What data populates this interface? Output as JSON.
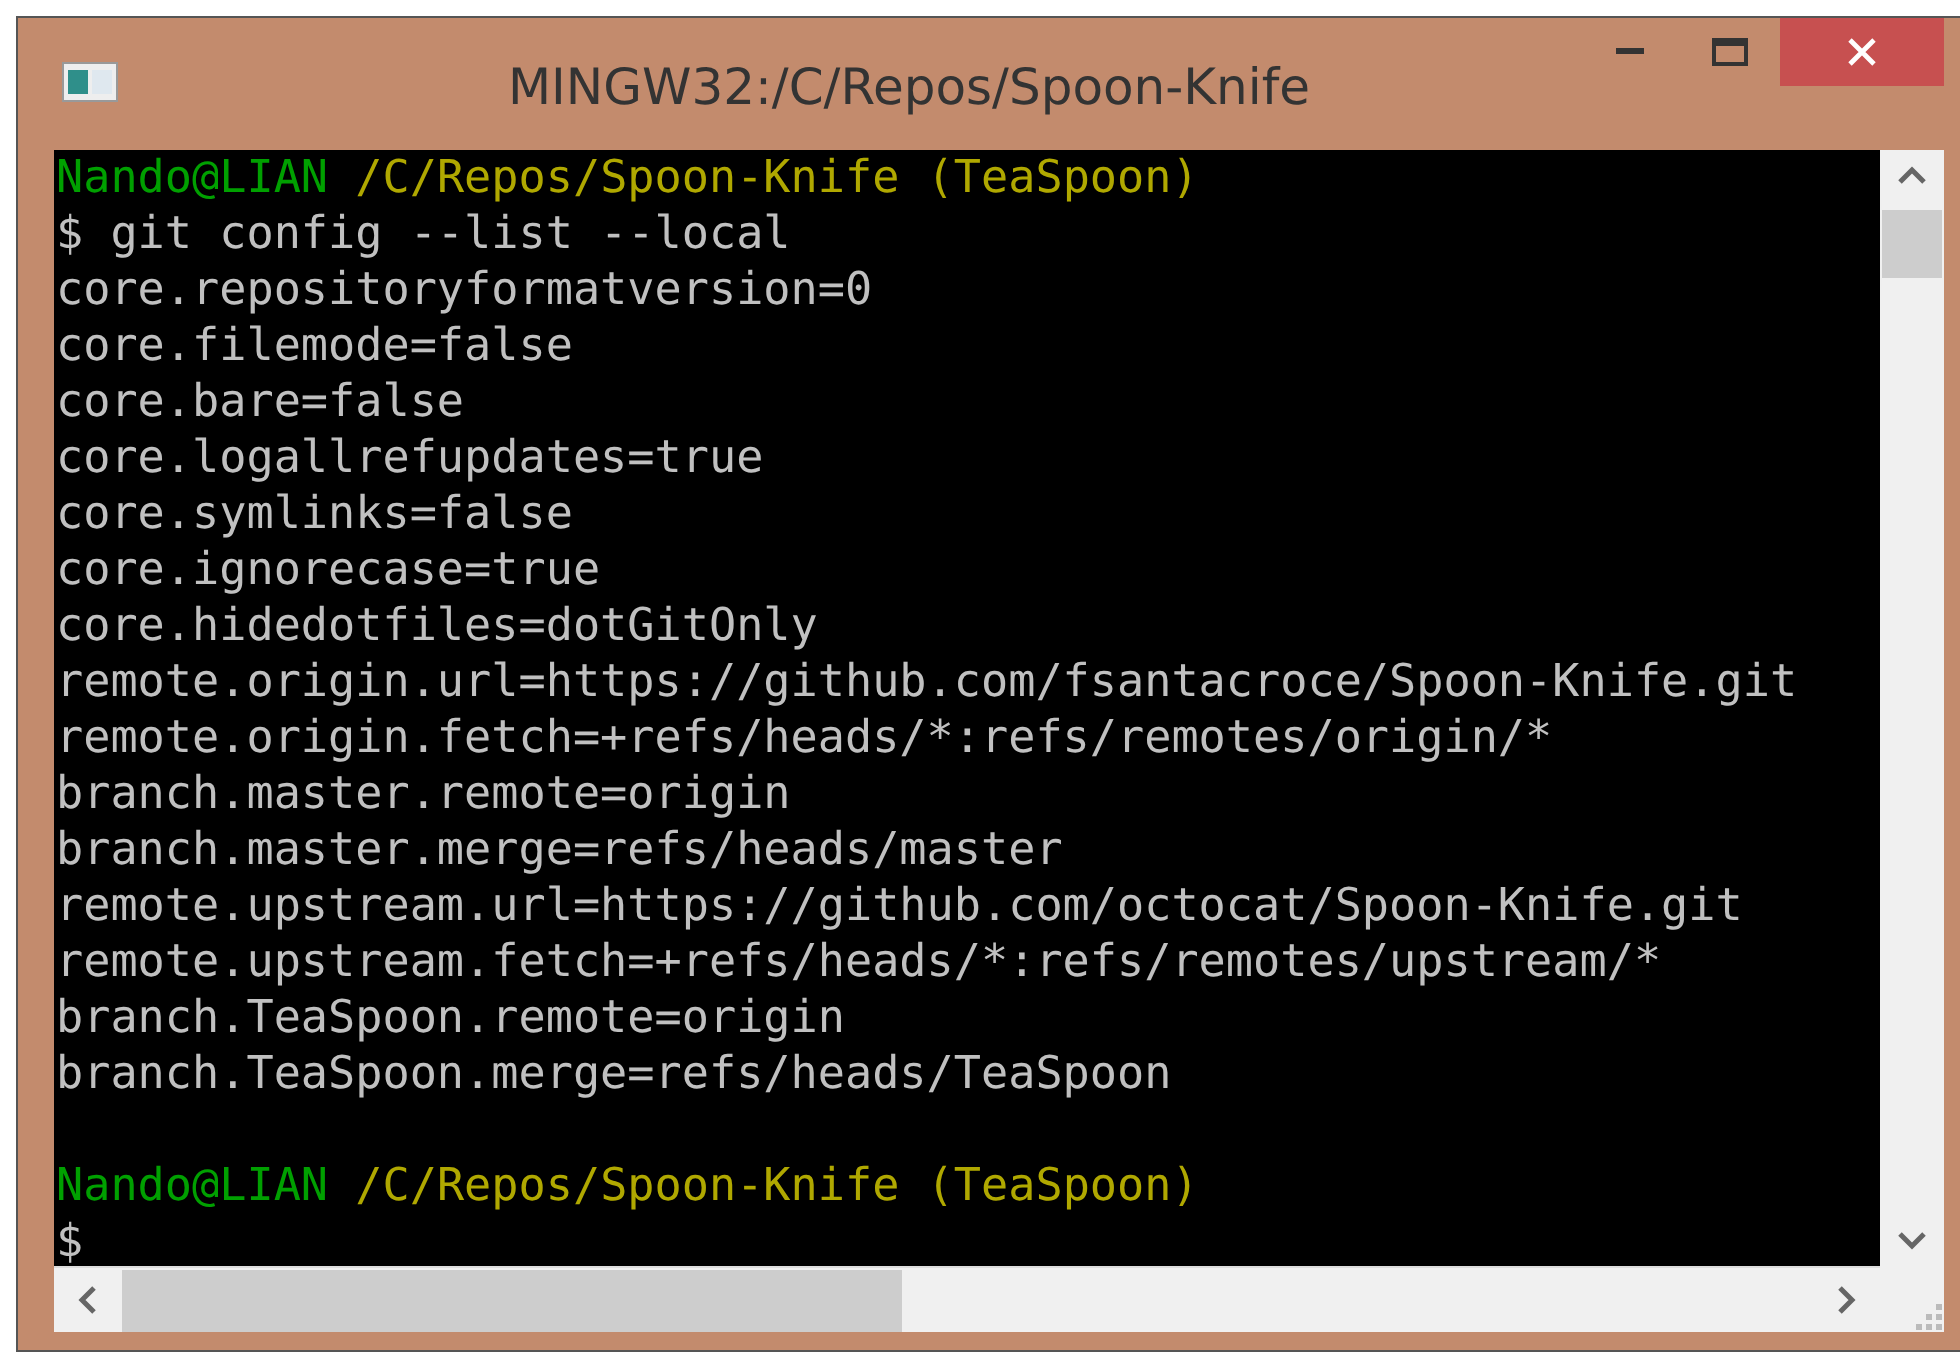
{
  "window": {
    "title": "MINGW32:/C/Repos/Spoon-Knife"
  },
  "terminal": {
    "lines": [
      {
        "kind": "prompt",
        "segments": [
          {
            "kind": "user",
            "text": "Nando@LIAN"
          },
          {
            "kind": "path",
            "text": "/C/Repos/Spoon-Knife"
          },
          {
            "kind": "branch",
            "text": "(TeaSpoon)"
          }
        ]
      },
      {
        "kind": "command",
        "text": "$ git config --list --local"
      },
      {
        "kind": "output",
        "text": "core.repositoryformatversion=0"
      },
      {
        "kind": "output",
        "text": "core.filemode=false"
      },
      {
        "kind": "output",
        "text": "core.bare=false"
      },
      {
        "kind": "output",
        "text": "core.logallrefupdates=true"
      },
      {
        "kind": "output",
        "text": "core.symlinks=false"
      },
      {
        "kind": "output",
        "text": "core.ignorecase=true"
      },
      {
        "kind": "output",
        "text": "core.hidedotfiles=dotGitOnly"
      },
      {
        "kind": "output",
        "text": "remote.origin.url=https://github.com/fsantacroce/Spoon-Knife.git"
      },
      {
        "kind": "output",
        "text": "remote.origin.fetch=+refs/heads/*:refs/remotes/origin/*"
      },
      {
        "kind": "output",
        "text": "branch.master.remote=origin"
      },
      {
        "kind": "output",
        "text": "branch.master.merge=refs/heads/master"
      },
      {
        "kind": "output",
        "text": "remote.upstream.url=https://github.com/octocat/Spoon-Knife.git"
      },
      {
        "kind": "output",
        "text": "remote.upstream.fetch=+refs/heads/*:refs/remotes/upstream/*"
      },
      {
        "kind": "output",
        "text": "branch.TeaSpoon.remote=origin"
      },
      {
        "kind": "output",
        "text": "branch.TeaSpoon.merge=refs/heads/TeaSpoon"
      },
      {
        "kind": "blank"
      },
      {
        "kind": "prompt",
        "segments": [
          {
            "kind": "user",
            "text": "Nando@LIAN"
          },
          {
            "kind": "path",
            "text": "/C/Repos/Spoon-Knife"
          },
          {
            "kind": "branch",
            "text": "(TeaSpoon)"
          }
        ]
      },
      {
        "kind": "command",
        "text": "$"
      }
    ]
  }
}
